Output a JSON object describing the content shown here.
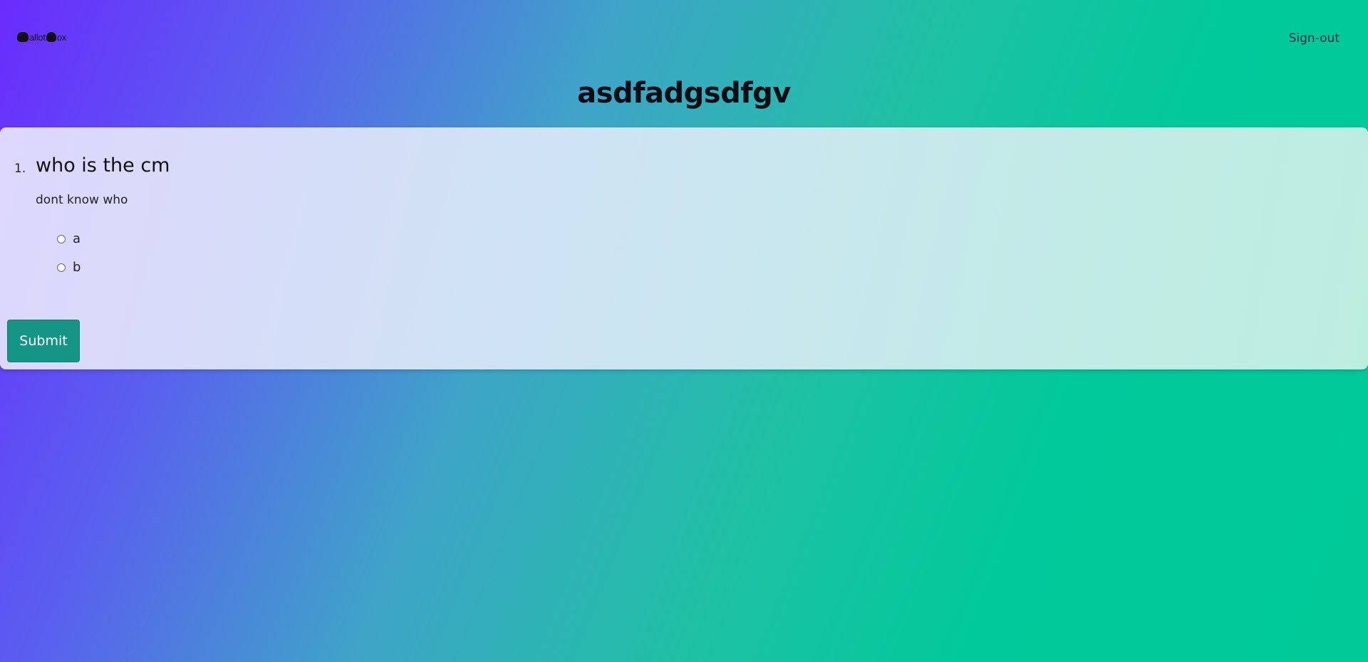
{
  "navbar": {
    "brand_text_1": "allot",
    "brand_text_2": "ox",
    "signout_label": "Sign-out"
  },
  "poll": {
    "title": "asdfadgsdfgv",
    "questions": [
      {
        "number": "1.",
        "title": "who is the cm",
        "description": "dont know who",
        "options": [
          "a",
          "b"
        ]
      }
    ],
    "submit_label": "Submit"
  },
  "colors": {
    "gradient_start": "#6a2bfd",
    "gradient_end": "#00c998",
    "submit_button": "#149585"
  }
}
